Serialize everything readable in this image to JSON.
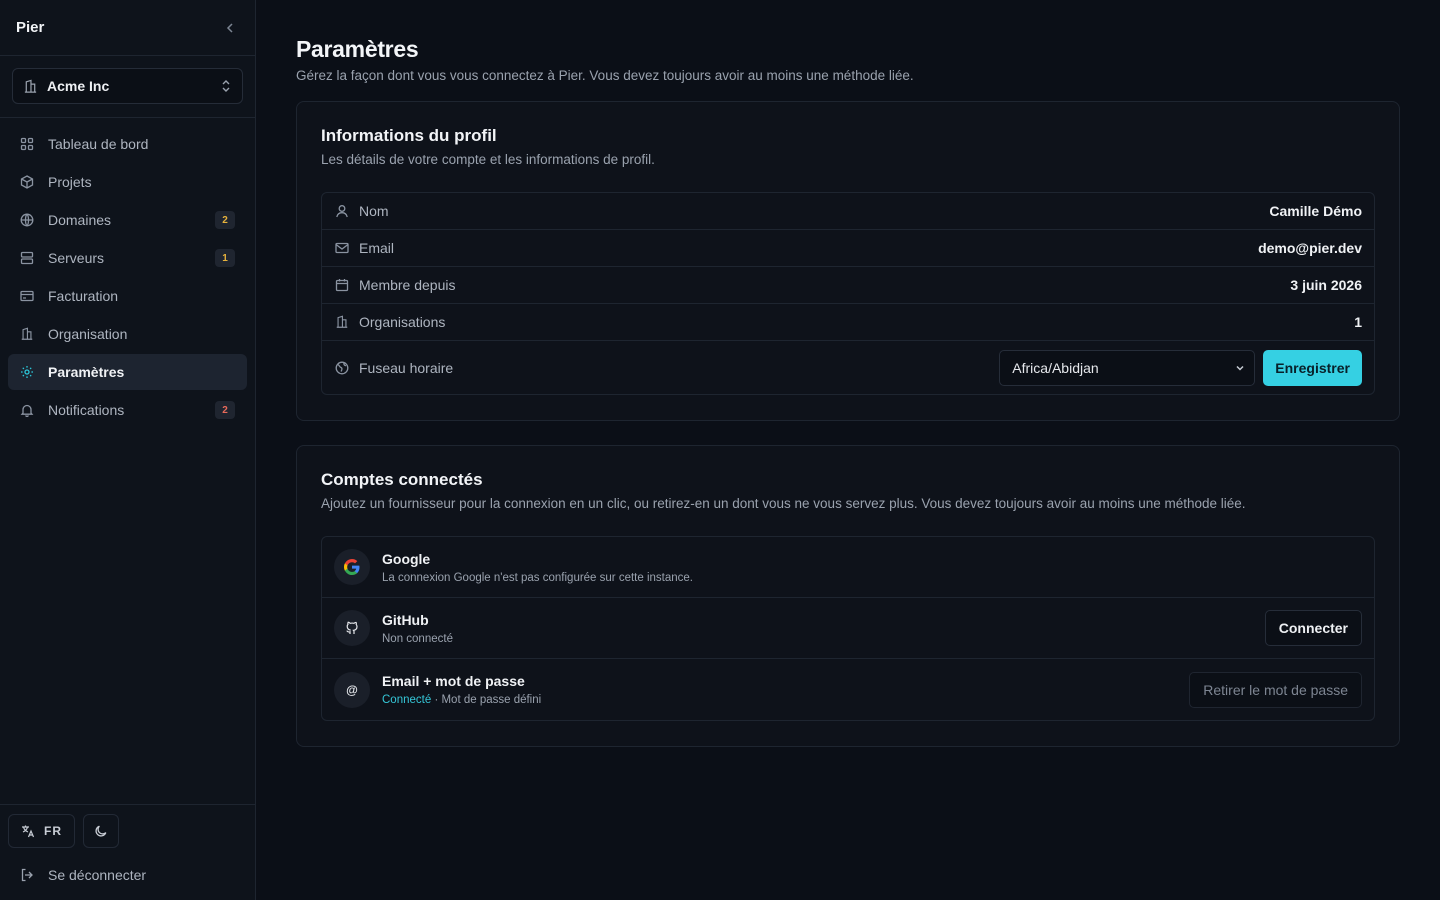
{
  "sidebar": {
    "brand": "Pier",
    "org_switcher": {
      "name": "Acme Inc"
    },
    "nav": [
      {
        "label": "Tableau de bord",
        "icon": "dashboard-icon"
      },
      {
        "label": "Projets",
        "icon": "box-icon"
      },
      {
        "label": "Domaines",
        "icon": "globe-icon",
        "badge": "2",
        "badge_color": "#e7b23c"
      },
      {
        "label": "Serveurs",
        "icon": "server-icon",
        "badge": "1",
        "badge_color": "#e7b23c"
      },
      {
        "label": "Facturation",
        "icon": "credit-card-icon"
      },
      {
        "label": "Organisation",
        "icon": "building-icon"
      },
      {
        "label": "Paramètres",
        "icon": "gear-icon",
        "active": true
      },
      {
        "label": "Notifications",
        "icon": "bell-icon",
        "badge": "2",
        "badge_color": "#e86a5a"
      }
    ],
    "footer": {
      "language": "FR",
      "logout": "Se déconnecter"
    }
  },
  "page": {
    "title": "Paramètres",
    "subtitle": "Gérez la façon dont vous vous connectez à Pier. Vous devez toujours avoir au moins une méthode liée."
  },
  "profile": {
    "title": "Informations du profil",
    "subtitle": "Les détails de votre compte et les informations de profil.",
    "rows": [
      {
        "label": "Nom",
        "value": "Camille Démo",
        "icon": "user-icon"
      },
      {
        "label": "Email",
        "value": "demo@pier.dev",
        "icon": "mail-icon"
      },
      {
        "label": "Membre depuis",
        "value": "3 juin 2026",
        "icon": "calendar-icon"
      },
      {
        "label": "Organisations",
        "value": "1",
        "icon": "building-icon"
      }
    ],
    "timezone": {
      "label": "Fuseau horaire",
      "value": "Africa/Abidjan",
      "save_label": "Enregistrer"
    }
  },
  "accounts": {
    "title": "Comptes connectés",
    "subtitle": "Ajoutez un fournisseur pour la connexion en un clic, ou retirez-en un dont vous ne vous servez plus. Vous devez toujours avoir au moins une méthode liée.",
    "items": [
      {
        "name": "Google",
        "desc": "La connexion Google n'est pas configurée sur cette instance."
      },
      {
        "name": "GitHub",
        "desc": "Non connecté",
        "action": "Connecter"
      },
      {
        "name": "Email + mot de passe",
        "status": "Connecté",
        "desc": "· Mot de passe défini",
        "action": "Retirer le mot de passe",
        "icon_text": "@"
      }
    ]
  },
  "colors": {
    "accent": "#35d0e3",
    "background": "#0b0f17",
    "sidebar": "#0e131b"
  }
}
